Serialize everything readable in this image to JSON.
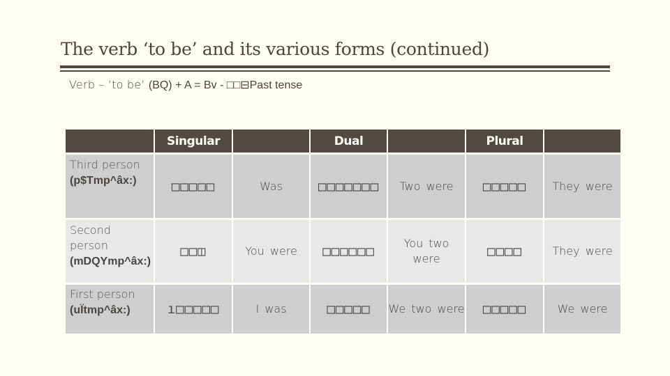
{
  "title": "The verb ‘to be’ and its various forms (continued)",
  "subtitle": {
    "light": "Verb – ‘to be’ ",
    "bold": "(BQ) + A = Bv - □□⊟Past tense"
  },
  "table": {
    "headers": [
      "",
      "Singular",
      "",
      "Dual",
      "",
      "Plural",
      ""
    ],
    "rows": [
      {
        "person": "Third person",
        "code": "(p$Tmp^âx:)",
        "singular_native": "□□□□□",
        "singular_english": "Was",
        "dual_native": "□□□□□□□",
        "dual_english": "Two were",
        "plural_native": "□□□□□",
        "plural_english": "They were"
      },
      {
        "person": "Second person",
        "code": "(mDQYmp^âx:)",
        "singular_native": "□□◫",
        "singular_english": "You were",
        "dual_native": "□□□□□□",
        "dual_english": "You two were",
        "plural_native": "□□□□",
        "plural_english": "They were"
      },
      {
        "person": "First person",
        "code": "(uÏtmp^âx:)",
        "singular_native": "ı□□□□□",
        "singular_english": "I was",
        "dual_native": "□□□□□",
        "dual_english": "We two were",
        "plural_native": "□□□□□",
        "plural_english": "We were"
      }
    ]
  }
}
